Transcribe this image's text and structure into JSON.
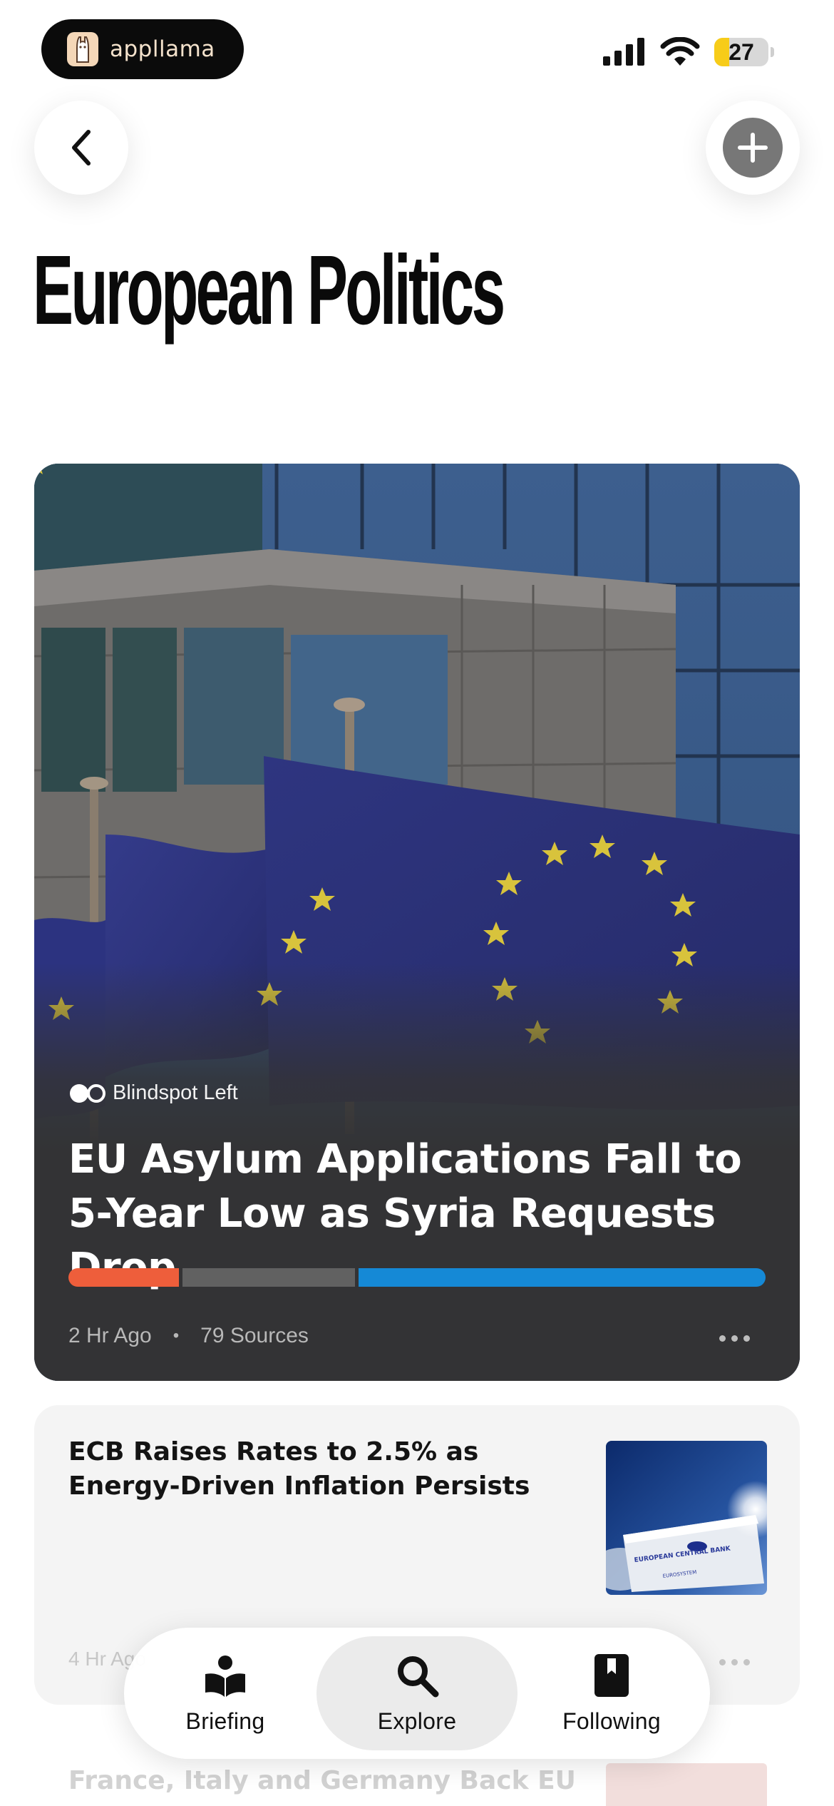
{
  "status_bar": {
    "app_name": "appllama",
    "battery_level": "27",
    "battery_fraction": 0.27,
    "icons": [
      "llama-logo-icon",
      "cellular-signal-icon",
      "wifi-icon",
      "battery-icon"
    ]
  },
  "header": {
    "back_icon": "chevron-left-icon",
    "add_icon": "plus-icon",
    "title": "European Politics"
  },
  "hero_story": {
    "tag": "Blindspot Left",
    "tag_icon": "blindspot-icon",
    "headline": "EU Asylum Applications Fall to 5-Year Low as Syria Requests Drop",
    "bias_distribution": {
      "left": 0.16,
      "center": 0.25,
      "right": 0.59,
      "colors": {
        "left": "#EE5E3B",
        "center": "#616161",
        "right": "#1589D6"
      }
    },
    "time": "2 Hr Ago",
    "separator": "•",
    "sources": "79 Sources",
    "more_icon": "more-horizontal-icon"
  },
  "stories": [
    {
      "headline": "ECB Raises Rates to 2.5% as Energy-Driven Inflation Persists",
      "time": "4 Hr Ago",
      "thumbnail_text": "EUROPEAN CENTRAL BANK",
      "thumbnail_subtext": "EUROSYSTEM",
      "more_icon": "more-horizontal-icon"
    },
    {
      "headline": "France, Italy and Germany Back EU"
    }
  ],
  "tab_bar": {
    "tabs": [
      {
        "label": "Briefing",
        "icon": "book-reader-icon",
        "active": false
      },
      {
        "label": "Explore",
        "icon": "search-icon",
        "active": true
      },
      {
        "label": "Following",
        "icon": "bookmark-icon",
        "active": false
      }
    ]
  }
}
